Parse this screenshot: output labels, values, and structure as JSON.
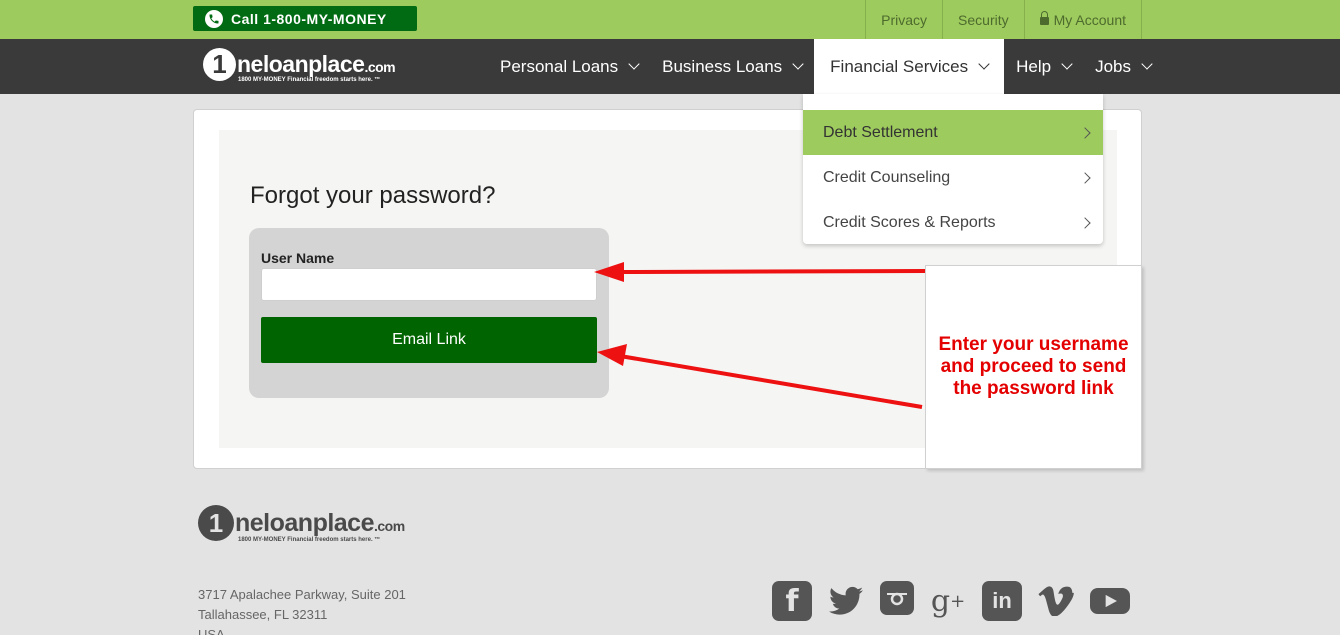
{
  "topbar": {
    "call_label": "Call 1-800-MY-MONEY",
    "links": [
      "Privacy",
      "Security",
      "My Account"
    ]
  },
  "logo": {
    "one": "1",
    "name": "neloanplace",
    "domain": ".com",
    "tagline": "1800 MY-MONEY Financial freedom starts here. ™"
  },
  "nav": {
    "items": [
      "Personal Loans",
      "Business Loans",
      "Financial Services",
      "Help",
      "Jobs"
    ]
  },
  "dropdown": {
    "items": [
      "Debt Settlement",
      "Credit Counseling",
      "Credit Scores & Reports"
    ]
  },
  "form": {
    "title": "Forgot your password?",
    "username_label": "User Name",
    "username_value": "",
    "button_label": "Email Link"
  },
  "annotation": {
    "text": "Enter your username and proceed to send the password link",
    "color": "#e40000"
  },
  "footer": {
    "address_line1": "3717 Apalachee Parkway, Suite 201",
    "address_line2": "Tallahassee, FL 32311",
    "address_line3": "USA",
    "social_icons": [
      "facebook-icon",
      "twitter-icon",
      "instagram-icon",
      "google-plus-icon",
      "linkedin-icon",
      "vimeo-icon",
      "youtube-icon"
    ]
  },
  "colors": {
    "topbar": "#9ecb5e",
    "navbar": "#3a3a3a",
    "brand_green": "#006400",
    "highlight": "#9ecb5e"
  }
}
